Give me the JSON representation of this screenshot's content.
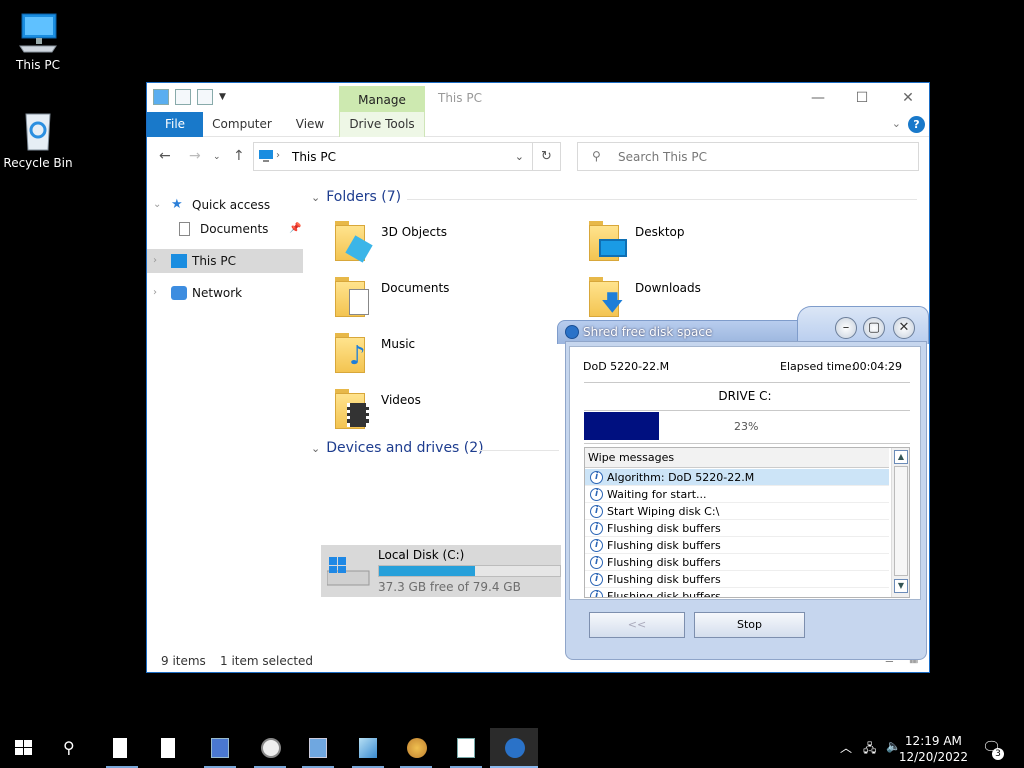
{
  "desktop": {
    "icons": [
      {
        "label": "This PC"
      },
      {
        "label": "Recycle Bin"
      }
    ]
  },
  "explorer": {
    "title": "This PC",
    "manage_tab": "Manage",
    "ribbon_tabs": [
      "File",
      "Computer",
      "View",
      "Drive Tools"
    ],
    "address": "This PC",
    "search_placeholder": "Search This PC",
    "nav": [
      {
        "label": "Quick access"
      },
      {
        "label": "Documents"
      },
      {
        "label": "This PC"
      },
      {
        "label": "Network"
      }
    ],
    "folders_header": "Folders (7)",
    "folders": [
      "3D Objects",
      "Desktop",
      "Documents",
      "Downloads",
      "Music",
      "Videos"
    ],
    "devices_header": "Devices and drives (2)",
    "disk": {
      "name": "Local Disk (C:)",
      "free": "37.3 GB free of 79.4 GB",
      "used_fraction": 0.53
    },
    "status": {
      "items": "9 items",
      "selected": "1 item selected"
    }
  },
  "shred": {
    "title": "Shred free disk space",
    "algorithm": "DoD 5220-22.M",
    "elapsed_label": "Elapsed time:",
    "elapsed": "00:04:29",
    "drive": "DRIVE C:",
    "percent": "23%",
    "percent_value": 23,
    "list_header": "Wipe messages",
    "messages": [
      "Algorithm: DoD 5220-22.M",
      "Waiting for start...",
      "Start Wiping disk C:\\",
      "Flushing disk buffers",
      "Flushing disk buffers",
      "Flushing disk buffers",
      "Flushing disk buffers",
      "Flushing disk buffers"
    ],
    "back_label": "<<",
    "stop_label": "Stop"
  },
  "taskbar": {
    "time": "12:19 AM",
    "date": "12/20/2022",
    "notifications": "3"
  }
}
